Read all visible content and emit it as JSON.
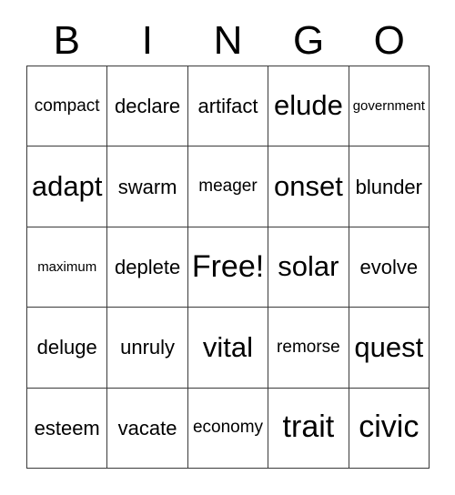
{
  "header": {
    "letters": [
      {
        "label": "B"
      },
      {
        "label": "I"
      },
      {
        "label": "N"
      },
      {
        "label": "G"
      },
      {
        "label": "O"
      }
    ]
  },
  "grid": {
    "columns": 5,
    "rows": 5,
    "free_space_label": "Free!",
    "border_color": "#3a3a3a",
    "background_color": "#ffffff",
    "text_color": "#000000",
    "cells": [
      [
        {
          "text": "compact",
          "size": "s",
          "free": false
        },
        {
          "text": "declare",
          "size": "m",
          "free": false
        },
        {
          "text": "artifact",
          "size": "m",
          "free": false
        },
        {
          "text": "elude",
          "size": "xl",
          "free": false
        },
        {
          "text": "government",
          "size": "xs",
          "free": false
        }
      ],
      [
        {
          "text": "adapt",
          "size": "xl",
          "free": false
        },
        {
          "text": "swarm",
          "size": "m",
          "free": false
        },
        {
          "text": "meager",
          "size": "s",
          "free": false
        },
        {
          "text": "onset",
          "size": "xl",
          "free": false
        },
        {
          "text": "blunder",
          "size": "m",
          "free": false
        }
      ],
      [
        {
          "text": "maximum",
          "size": "xs",
          "free": false
        },
        {
          "text": "deplete",
          "size": "m",
          "free": false
        },
        {
          "text": "Free!",
          "size": "xxl",
          "free": true
        },
        {
          "text": "solar",
          "size": "xl",
          "free": false
        },
        {
          "text": "evolve",
          "size": "m",
          "free": false
        }
      ],
      [
        {
          "text": "deluge",
          "size": "m",
          "free": false
        },
        {
          "text": "unruly",
          "size": "m",
          "free": false
        },
        {
          "text": "vital",
          "size": "xl",
          "free": false
        },
        {
          "text": "remorse",
          "size": "s",
          "free": false
        },
        {
          "text": "quest",
          "size": "xl",
          "free": false
        }
      ],
      [
        {
          "text": "esteem",
          "size": "m",
          "free": false
        },
        {
          "text": "vacate",
          "size": "m",
          "free": false
        },
        {
          "text": "economy",
          "size": "s",
          "free": false
        },
        {
          "text": "trait",
          "size": "xxl",
          "free": false
        },
        {
          "text": "civic",
          "size": "xxl",
          "free": false
        }
      ]
    ]
  }
}
